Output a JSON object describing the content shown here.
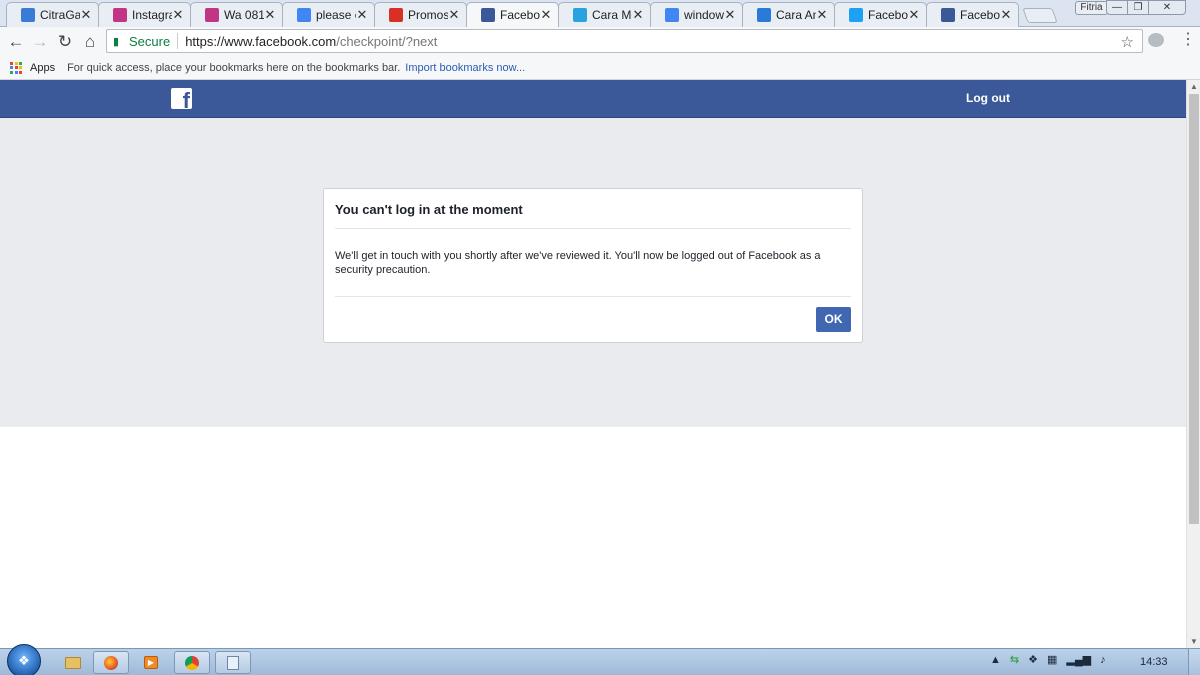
{
  "browser": {
    "tabs": [
      {
        "title": "CitraGar",
        "icon": "citragar-favicon",
        "color": "#3a7bd5",
        "active": false
      },
      {
        "title": "Instagra",
        "icon": "instagram-icon",
        "color": "#c13584",
        "active": false
      },
      {
        "title": "Wa 081",
        "icon": "instagram-icon",
        "color": "#c13584",
        "active": false
      },
      {
        "title": "please c",
        "icon": "google-icon",
        "color": "#4285f4",
        "active": false
      },
      {
        "title": "Promosi",
        "icon": "gmail-icon",
        "color": "#d93025",
        "active": false
      },
      {
        "title": "Faceboo",
        "icon": "facebook-icon",
        "color": "#3b5998",
        "active": true
      },
      {
        "title": "Cara Me",
        "icon": "app-favicon",
        "color": "#29a3df",
        "active": false
      },
      {
        "title": "window:",
        "icon": "google-icon",
        "color": "#4285f4",
        "active": false
      },
      {
        "title": "Cara An",
        "icon": "mt-favicon",
        "color": "#2a7bd8",
        "active": false
      },
      {
        "title": "Faceboo",
        "icon": "twitter-icon",
        "color": "#1da1f2",
        "active": false
      },
      {
        "title": "Faceboo",
        "icon": "facebook-icon",
        "color": "#3b5998",
        "active": false
      }
    ],
    "user_badge": "Fitria",
    "address": {
      "secure_label": "Secure",
      "url_host": "https://www.facebook.com",
      "url_path": "/checkpoint/?next"
    },
    "bookmarks": {
      "apps_label": "Apps",
      "hint": "For quick access, place your bookmarks here on the bookmarks bar.",
      "import_link": "Import bookmarks now..."
    }
  },
  "page": {
    "header": {
      "logo": "f",
      "logout_label": "Log out"
    },
    "dialog": {
      "title": "You can't log in at the moment",
      "body": "We'll get in touch with you shortly after we've reviewed it. You'll now be logged out of Facebook as a security precaution.",
      "ok_label": "OK"
    }
  },
  "taskbar": {
    "clock": "14:33"
  },
  "colors": {
    "facebook_blue": "#3b5998",
    "button_blue": "#4267b2",
    "page_gray": "#e9ebee",
    "secure_green": "#0b8043"
  }
}
